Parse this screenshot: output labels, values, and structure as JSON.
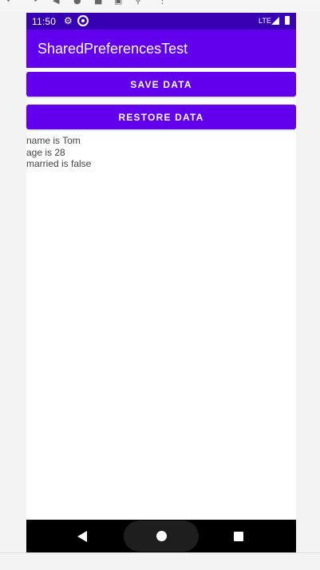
{
  "status_bar": {
    "time": "11:50",
    "network": "LTE",
    "icons": [
      "gear-icon",
      "sync-icon",
      "signal-icon",
      "battery-icon"
    ]
  },
  "app_bar": {
    "title": "SharedPreferencesTest"
  },
  "buttons": {
    "save_label": "SAVE DATA",
    "restore_label": "RESTORE DATA"
  },
  "output_lines": [
    "name is Tom",
    "age is 28",
    "married is false"
  ],
  "nav_bar": {
    "icons": [
      "back-icon",
      "home-icon",
      "recents-icon"
    ]
  },
  "colors": {
    "primary": "#6200EE",
    "primary_dark": "#3700B3",
    "background": "#FFFFFF"
  }
}
